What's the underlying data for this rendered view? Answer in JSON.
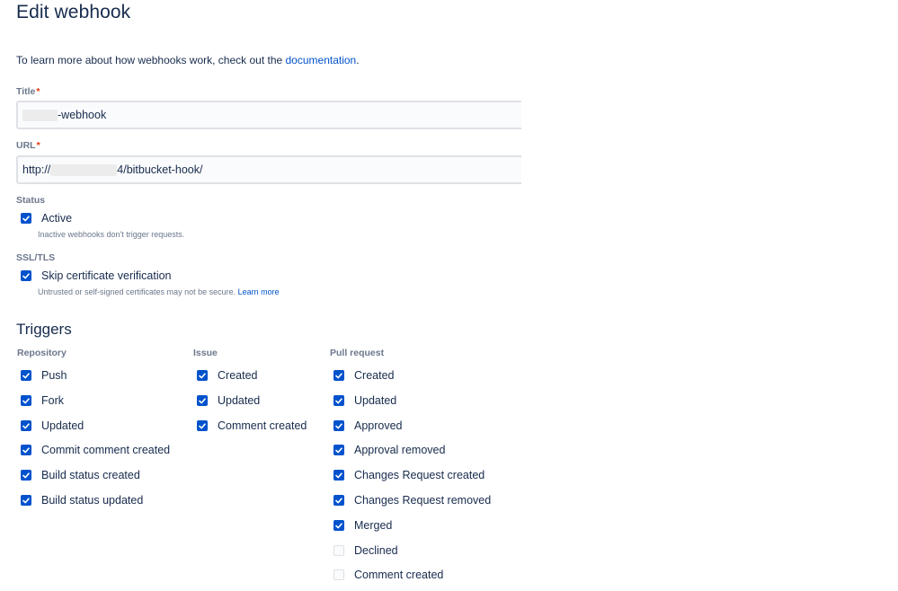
{
  "page": {
    "title": "Edit webhook",
    "intro_text": "To learn more about how webhooks work, check out the ",
    "intro_link": "documentation",
    "intro_end": "."
  },
  "form": {
    "title_label": "Title",
    "title_value": "-webhook",
    "url_label": "URL",
    "url_value_prefix": "http://",
    "url_value_suffix": "4/bitbucket-hook/",
    "required_mark": "*"
  },
  "status": {
    "label": "Status",
    "option_label": "Active",
    "checked": true,
    "helper": "Inactive webhooks don't trigger requests."
  },
  "ssl": {
    "label": "SSL/TLS",
    "option_label": "Skip certificate verification",
    "checked": true,
    "helper": "Untrusted or self-signed certificates may not be secure. ",
    "helper_link": "Learn more"
  },
  "triggers": {
    "heading": "Triggers",
    "repository": {
      "label": "Repository",
      "items": [
        {
          "label": "Push",
          "checked": true
        },
        {
          "label": "Fork",
          "checked": true
        },
        {
          "label": "Updated",
          "checked": true
        },
        {
          "label": "Commit comment created",
          "checked": true
        },
        {
          "label": "Build status created",
          "checked": true
        },
        {
          "label": "Build status updated",
          "checked": true
        }
      ]
    },
    "issue": {
      "label": "Issue",
      "items": [
        {
          "label": "Created",
          "checked": true
        },
        {
          "label": "Updated",
          "checked": true
        },
        {
          "label": "Comment created",
          "checked": true
        }
      ]
    },
    "pull_request": {
      "label": "Pull request",
      "items": [
        {
          "label": "Created",
          "checked": true
        },
        {
          "label": "Updated",
          "checked": true
        },
        {
          "label": "Approved",
          "checked": true
        },
        {
          "label": "Approval removed",
          "checked": true
        },
        {
          "label": "Changes Request created",
          "checked": true
        },
        {
          "label": "Changes Request removed",
          "checked": true
        },
        {
          "label": "Merged",
          "checked": true
        },
        {
          "label": "Declined",
          "checked": false
        },
        {
          "label": "Comment created",
          "checked": false
        }
      ]
    }
  },
  "colors": {
    "accent": "#0052cc",
    "text": "#172b4d",
    "subtle": "#6b778c",
    "required": "#de350b"
  }
}
